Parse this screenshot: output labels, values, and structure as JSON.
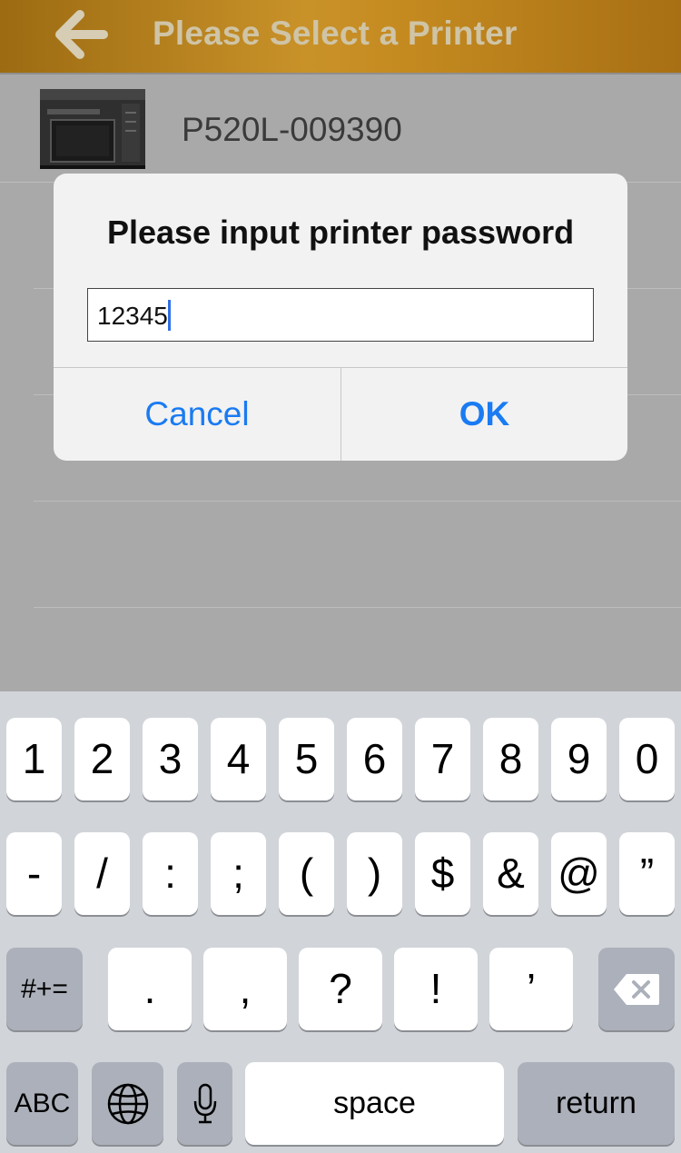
{
  "header": {
    "title": "Please Select a Printer",
    "back_icon": "left-arrow-icon"
  },
  "printer_list": {
    "items": [
      {
        "name": "P520L-009390",
        "icon": "printer-image"
      }
    ]
  },
  "dialog": {
    "title": "Please input printer password",
    "input_value": "12345",
    "cancel_label": "Cancel",
    "ok_label": "OK",
    "button_color": "#1a7bf2"
  },
  "keyboard": {
    "row1": [
      "1",
      "2",
      "3",
      "4",
      "5",
      "6",
      "7",
      "8",
      "9",
      "0"
    ],
    "row2": [
      "-",
      "/",
      ":",
      ";",
      "(",
      ")",
      "$",
      "&",
      "@",
      "”"
    ],
    "row3_mode": "#+=",
    "row3": [
      ".",
      ",",
      "?",
      "!",
      "’"
    ],
    "backspace_icon": "backspace-icon",
    "row4_mode": "ABC",
    "globe_icon": "globe-icon",
    "mic_icon": "microphone-icon",
    "space_label": "space",
    "return_label": "return"
  }
}
